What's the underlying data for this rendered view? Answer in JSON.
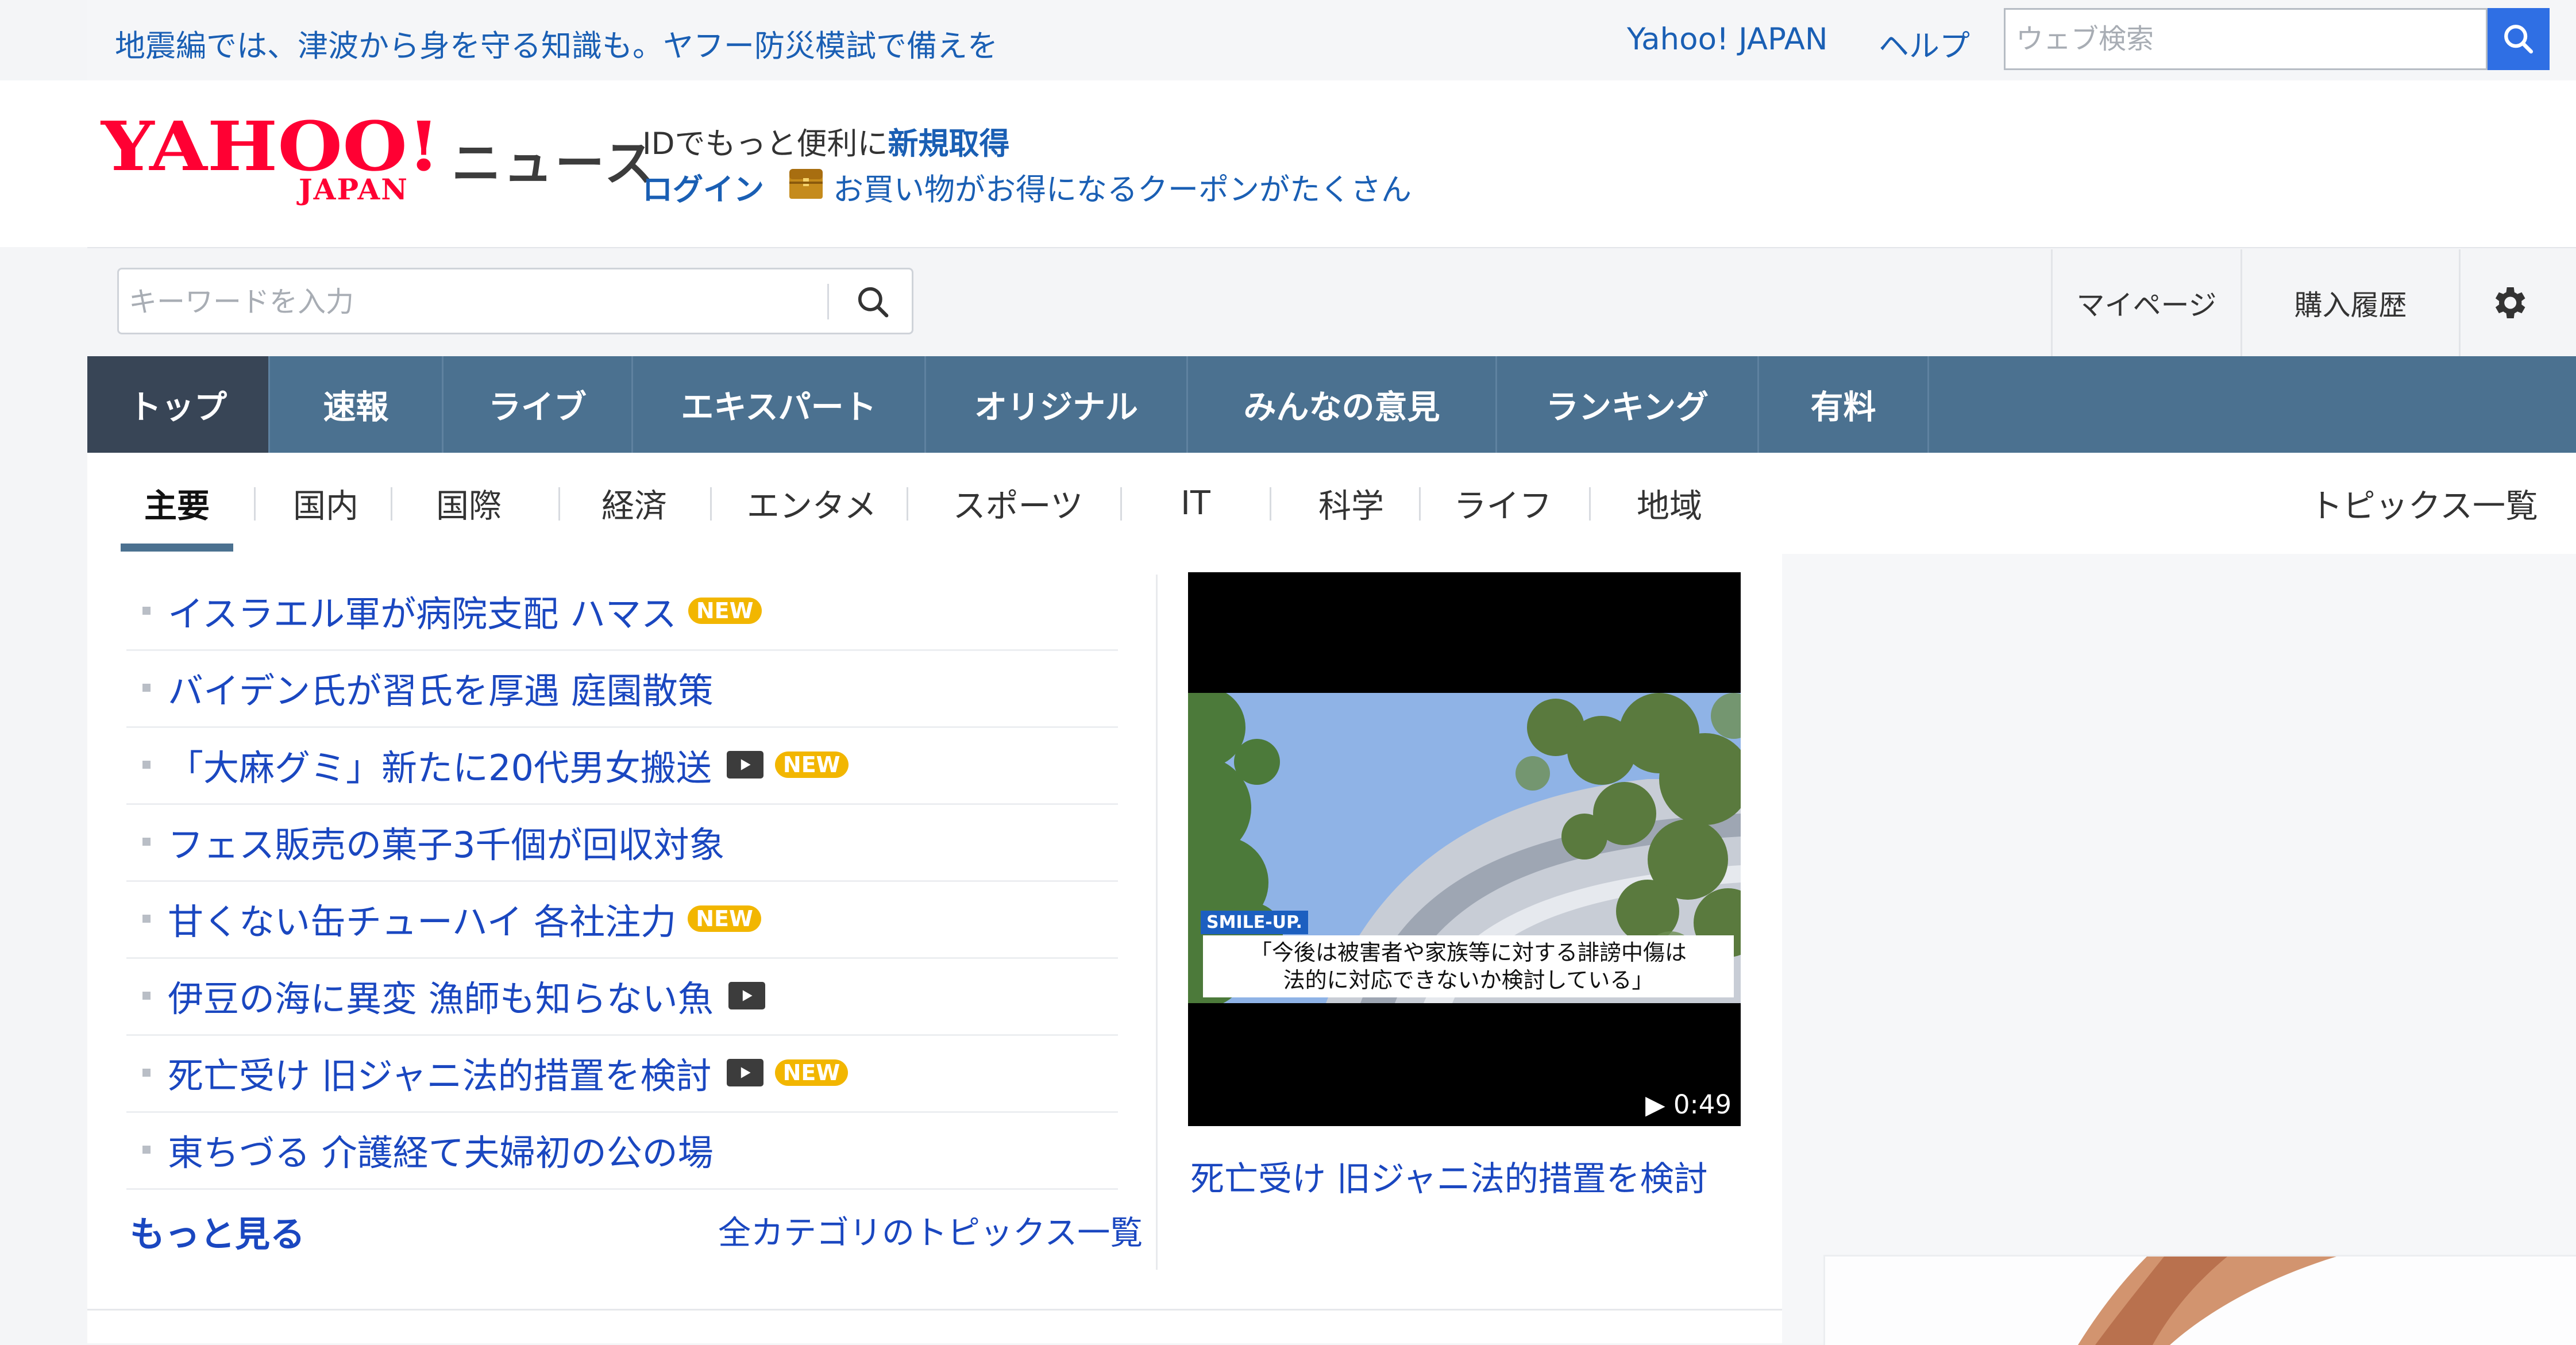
{
  "top_bar": {
    "announcement": "地震編では、津波から身を守る知識も。ヤフー防災模試で備えを",
    "yahoo_japan_link": "Yahoo! JAPAN",
    "help_link": "ヘルプ",
    "web_search_placeholder": "ウェブ検索"
  },
  "header": {
    "logo_text": "YAHOO!",
    "logo_subtext": "JAPAN",
    "service_name": "ニュース",
    "id_prompt": "IDでもっと便利に",
    "register_link": "新規取得",
    "login_link": "ログイン",
    "coupon_text": "お買い物がお得になるクーポンがたくさん"
  },
  "search": {
    "keyword_placeholder": "キーワードを入力"
  },
  "user_links": {
    "mypage": "マイページ",
    "purchase_history": "購入履歴"
  },
  "main_nav": [
    {
      "label": "トップ",
      "active": true
    },
    {
      "label": "速報"
    },
    {
      "label": "ライブ"
    },
    {
      "label": "エキスパート"
    },
    {
      "label": "オリジナル"
    },
    {
      "label": "みんなの意見"
    },
    {
      "label": "ランキング"
    },
    {
      "label": "有料"
    }
  ],
  "sub_nav": [
    {
      "label": "主要",
      "active": true
    },
    {
      "label": "国内"
    },
    {
      "label": "国際"
    },
    {
      "label": "経済"
    },
    {
      "label": "エンタメ"
    },
    {
      "label": "スポーツ"
    },
    {
      "label": "IT"
    },
    {
      "label": "科学"
    },
    {
      "label": "ライフ"
    },
    {
      "label": "地域"
    }
  ],
  "topics_all_link": "トピックス一覧",
  "news_list": [
    {
      "title": "イスラエル軍が病院支配 ハマス",
      "video": false,
      "new": true
    },
    {
      "title": "バイデン氏が習氏を厚遇 庭園散策",
      "video": false,
      "new": false
    },
    {
      "title": "「大麻グミ」新たに20代男女搬送",
      "video": true,
      "new": true
    },
    {
      "title": "フェス販売の菓子3千個が回収対象",
      "video": false,
      "new": false
    },
    {
      "title": "甘くない缶チューハイ 各社注力",
      "video": false,
      "new": true
    },
    {
      "title": "伊豆の海に異変 漁師も知らない魚",
      "video": true,
      "new": false
    },
    {
      "title": "死亡受け 旧ジャニ法的措置を検討",
      "video": true,
      "new": true
    },
    {
      "title": "東ちづる 介護経て夫婦初の公の場",
      "video": false,
      "new": false
    }
  ],
  "new_badge": "NEW",
  "more_link": "もっと見る",
  "all_categories_link": "全カテゴリのトピックス一覧",
  "featured_video": {
    "caption_tag": "SMILE-UP.",
    "caption_line1": "「今後は被害者や家族等に対する誹謗中傷は",
    "caption_line2": "法的に対応できないか検討している」",
    "duration": "▶ 0:49",
    "title": "死亡受け 旧ジャニ法的措置を検討"
  },
  "colors": {
    "brand_red": "#ff0033",
    "link_blue": "#1a47c0",
    "nav_bg": "#4b7190",
    "nav_active": "#384556",
    "search_button": "#2f6fe4",
    "new_badge": "#f2b600"
  }
}
